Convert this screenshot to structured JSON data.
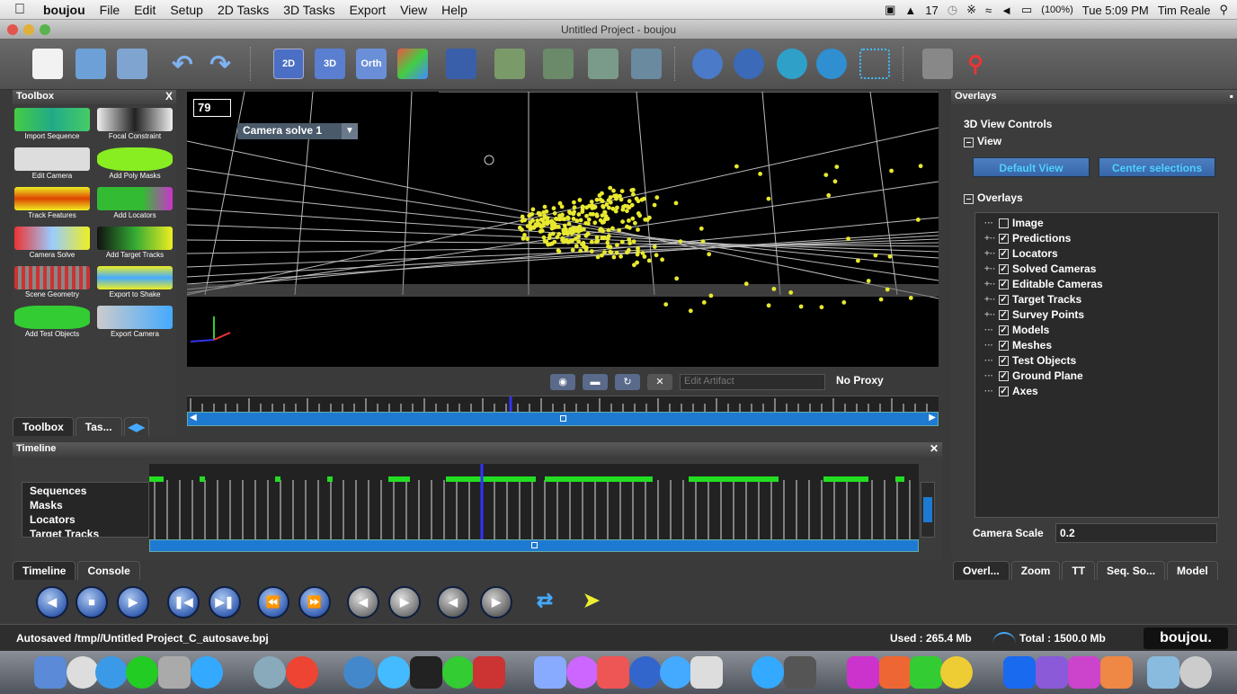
{
  "menubar": {
    "app": "boujou",
    "items": [
      "File",
      "Edit",
      "Setup",
      "2D Tasks",
      "3D Tasks",
      "Export",
      "View",
      "Help"
    ],
    "status_num": "17",
    "battery": "(100%)",
    "clock": "Tue 5:09 PM",
    "user": "Tim Reale"
  },
  "window": {
    "title": "Untitled Project - boujou"
  },
  "toolbar": {
    "view_buttons": [
      "2D",
      "3D",
      "Orth"
    ]
  },
  "toolbox": {
    "title": "Toolbox",
    "close": "X",
    "tools": [
      "Import Sequence",
      "Focal Constraint",
      "Edit Camera",
      "Add Poly Masks",
      "Track Features",
      "Add Locators",
      "Camera Solve",
      "Add Target Tracks",
      "Scene Geometry",
      "Export to Shake",
      "Add Test Objects",
      "Export Camera"
    ],
    "tabs": [
      "Toolbox",
      "Tas..."
    ]
  },
  "viewport": {
    "frame": "79",
    "camera_select": "Camera solve 1",
    "edit_artifact": "Edit Artifact",
    "proxy": "No Proxy"
  },
  "overlays": {
    "title": "Overlays",
    "controls_heading": "3D View Controls",
    "view_label": "View",
    "default_view": "Default View",
    "center_selections": "Center selections",
    "overlays_label": "Overlays",
    "tree": [
      {
        "label": "Image",
        "checked": false
      },
      {
        "label": "Predictions",
        "checked": true
      },
      {
        "label": "Locators",
        "checked": true
      },
      {
        "label": "Solved Cameras",
        "checked": true
      },
      {
        "label": "Editable Cameras",
        "checked": true
      },
      {
        "label": "Target Tracks",
        "checked": true
      },
      {
        "label": "Survey Points",
        "checked": true
      },
      {
        "label": "Models",
        "checked": true
      },
      {
        "label": "Meshes",
        "checked": true
      },
      {
        "label": "Test Objects",
        "checked": true
      },
      {
        "label": "Ground Plane",
        "checked": true
      },
      {
        "label": "Axes",
        "checked": true
      }
    ],
    "camera_scale_label": "Camera Scale",
    "camera_scale_value": "0.2",
    "tabs": [
      "Overl...",
      "Zoom",
      "TT",
      "Seq. So...",
      "Model"
    ]
  },
  "timeline": {
    "title": "Timeline",
    "items": [
      "Sequences",
      "Masks",
      "Locators",
      "Target Tracks"
    ],
    "tabs": [
      "Timeline",
      "Console"
    ]
  },
  "status": {
    "autosave": "Autosaved /tmp//Untitled Project_C_autosave.bpj",
    "used": "Used : 265.4 Mb",
    "total": "Total : 1500.0 Mb",
    "brand": "boujou."
  },
  "colors": {
    "accent_blue": "#1e7ad1",
    "track_green": "#22dd22",
    "point_yellow": "#e8e830"
  }
}
